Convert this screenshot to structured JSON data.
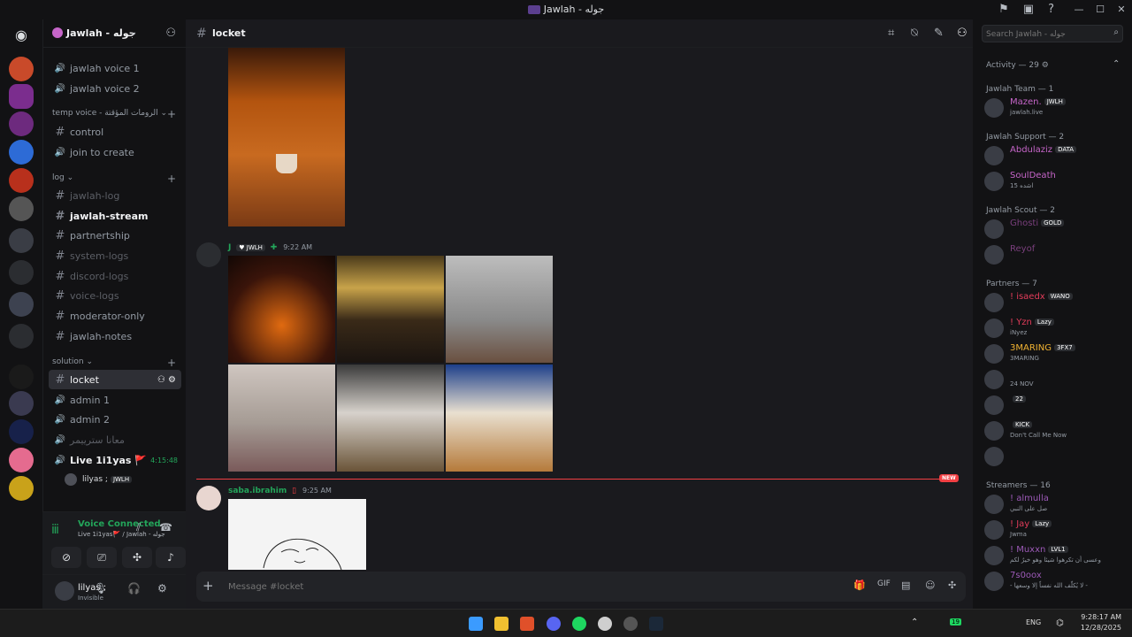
{
  "window": {
    "title": "Jawlah - جوله"
  },
  "server": {
    "name": "Jawlah - جوله"
  },
  "channels": [
    {
      "type": "voice",
      "label": "jawlah voice 1",
      "state": "normal"
    },
    {
      "type": "voice",
      "label": "jawlah voice 2",
      "state": "normal"
    },
    {
      "type": "category",
      "label": "temp voice - الرومات المؤقتة"
    },
    {
      "type": "text",
      "label": "control",
      "state": "normal"
    },
    {
      "type": "voice",
      "label": "join to create",
      "state": "normal"
    },
    {
      "type": "category",
      "label": "log"
    },
    {
      "type": "text",
      "label": "jawlah-log",
      "state": "dim"
    },
    {
      "type": "text",
      "label": "jawlah-stream",
      "state": "bright"
    },
    {
      "type": "text",
      "label": "partnertship",
      "state": "normal"
    },
    {
      "type": "text",
      "label": "system-logs",
      "state": "dim"
    },
    {
      "type": "text",
      "label": "discord-logs",
      "state": "dim"
    },
    {
      "type": "text",
      "label": "voice-logs",
      "state": "dim"
    },
    {
      "type": "text",
      "label": "moderator-only",
      "state": "normal"
    },
    {
      "type": "text",
      "label": "jawlah-notes",
      "state": "normal"
    },
    {
      "type": "category",
      "label": "solution"
    },
    {
      "type": "text",
      "label": "locket",
      "state": "selected"
    },
    {
      "type": "voice",
      "label": "admin 1",
      "state": "normal"
    },
    {
      "type": "voice",
      "label": "admin 2",
      "state": "normal"
    },
    {
      "type": "voice",
      "label": "معانا سترييمر",
      "state": "dim"
    },
    {
      "type": "voice",
      "label": "Live 1i1yas 🚩",
      "state": "live",
      "time": "4:15:48"
    }
  ],
  "voice_member": {
    "name": "lilyas ;",
    "tag": "JWLH"
  },
  "voice_status": {
    "title": "Voice Connected",
    "location": "Live 1i1yas🚩 / Jawlah - جوله"
  },
  "user": {
    "name": "lilyas ;",
    "status": "Invisible"
  },
  "channel_header": {
    "name": "locket"
  },
  "search": {
    "placeholder": "Search Jawlah - جوله"
  },
  "messages": [
    {
      "author": "J",
      "tag": "JWLH",
      "time": "9:22 AM"
    },
    {
      "author": "saba.ibrahim",
      "time": "9:25 AM"
    }
  ],
  "new_label": "NEW",
  "composer": {
    "placeholder": "Message #locket"
  },
  "members": {
    "activity": "Activity — 29",
    "groups": [
      {
        "label": "Jawlah Team — 1",
        "items": [
          {
            "name": "Mazen.",
            "tag": "JWLH",
            "sub": "jawlah.live",
            "color": "#c665c9"
          }
        ]
      },
      {
        "label": "Jawlah Support — 2",
        "items": [
          {
            "name": "Abdulaziz",
            "tag": "DATA",
            "sub": "",
            "color": "#c665c9"
          },
          {
            "name": "SoulDeath",
            "tag": "",
            "sub": "اشده 15",
            "color": "#c665c9"
          }
        ]
      },
      {
        "label": "Jawlah Scout — 2",
        "items": [
          {
            "name": "Ghosti",
            "tag": "GOLD",
            "sub": "",
            "color": "#7a3f7d"
          },
          {
            "name": "Reyof",
            "tag": "",
            "sub": "",
            "color": "#7a3f7d"
          }
        ]
      },
      {
        "label": "Partners — 7",
        "items": [
          {
            "name": "! isaedx",
            "tag": "WANO",
            "sub": "",
            "color": "#e23c5a"
          },
          {
            "name": "! Yzn",
            "tag": "Lazy",
            "sub": "iNyez",
            "color": "#e23c5a"
          },
          {
            "name": "3MARING",
            "tag": "3FX7",
            "sub": "3MARING",
            "color": "#f0b232"
          },
          {
            "name": "",
            "tag": "",
            "sub": "24 NOV",
            "color": "#9b59b6"
          },
          {
            "name": "",
            "tag": "22",
            "sub": "",
            "color": "#9b59b6"
          },
          {
            "name": "",
            "tag": "KICK",
            "sub": "Don't Call Me Now",
            "color": "#e23c5a"
          },
          {
            "name": "",
            "tag": "",
            "sub": "",
            "color": "#9b59b6"
          }
        ]
      },
      {
        "label": "Streamers — 16",
        "items": [
          {
            "name": "! almulla",
            "tag": "",
            "sub": "صل على النبي",
            "color": "#9b59b6"
          },
          {
            "name": "! Jay",
            "tag": "Lazy",
            "sub": "Jwma",
            "color": "#e23c5a"
          },
          {
            "name": "! Muxxn",
            "tag": "LVL1",
            "sub": "وعسى أن تكرهوا شيئا وهو خيرٌ لكم",
            "color": "#9b59b6"
          },
          {
            "name": "7s0oox",
            "tag": "",
            "sub": "- لا يُكلّف الله نفساً إلا وسعها -",
            "color": "#9b59b6"
          }
        ]
      }
    ]
  },
  "clock": {
    "time": "9:28:17 AM",
    "date": "12/28/2025"
  },
  "tray": {
    "lang": "ENG",
    "badge": "19"
  }
}
